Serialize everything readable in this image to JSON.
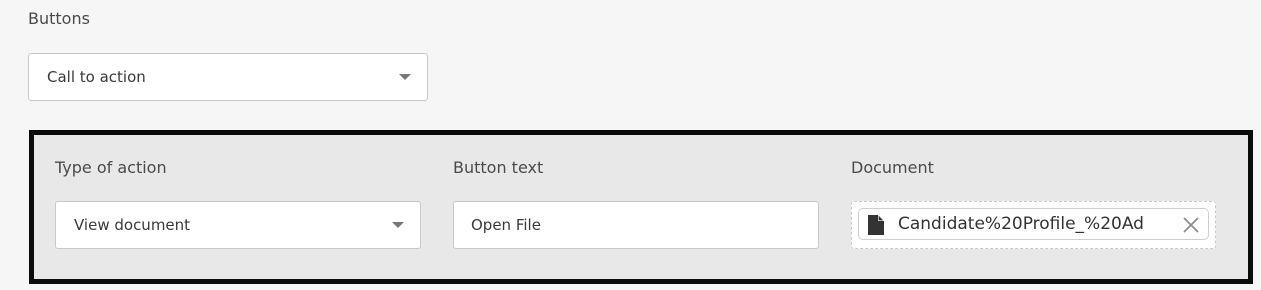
{
  "buttons_section": {
    "label": "Buttons",
    "select": {
      "value": "Call to action",
      "icon": "chevron-down-icon"
    }
  },
  "action_panel": {
    "type_of_action": {
      "label": "Type of action",
      "value": "View document",
      "icon": "chevron-down-icon"
    },
    "button_text": {
      "label": "Button text",
      "value": "Open File"
    },
    "document": {
      "label": "Document",
      "file_name": "Candidate%20Profile_%20Ad",
      "file_icon": "file-icon",
      "remove_icon": "close-icon"
    }
  },
  "colors": {
    "page_background": "#f6f6f6",
    "panel_background": "#e8e8e8",
    "panel_border": "#0b0b0b",
    "input_border": "#c9c9c9"
  }
}
